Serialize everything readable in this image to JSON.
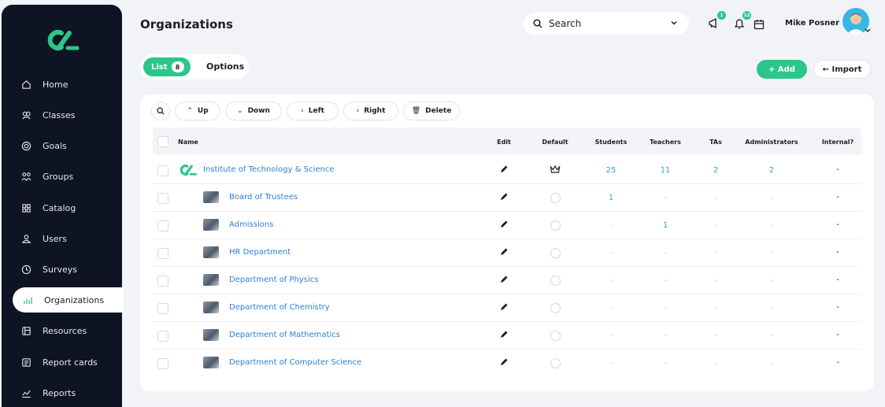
{
  "sidebar": {
    "items": [
      {
        "label": "Home",
        "icon": "home-icon"
      },
      {
        "label": "Classes",
        "icon": "classes-icon"
      },
      {
        "label": "Goals",
        "icon": "goals-icon"
      },
      {
        "label": "Groups",
        "icon": "groups-icon"
      },
      {
        "label": "Catalog",
        "icon": "catalog-icon"
      },
      {
        "label": "Users",
        "icon": "users-icon"
      },
      {
        "label": "Surveys",
        "icon": "surveys-icon"
      },
      {
        "label": "Organizations",
        "icon": "organizations-icon",
        "active": true
      },
      {
        "label": "Resources",
        "icon": "resources-icon"
      },
      {
        "label": "Report cards",
        "icon": "report-cards-icon"
      },
      {
        "label": "Reports",
        "icon": "reports-icon"
      }
    ]
  },
  "header": {
    "title": "Organizations",
    "search_label": "Search",
    "notifications_count": "1",
    "alerts_count": "12",
    "user_name": "Mike Posner"
  },
  "view": {
    "list_label": "List",
    "list_count": "8",
    "options_label": "Options"
  },
  "actions": {
    "add_label": "+ Add",
    "import_label": "← Import"
  },
  "toolbar": {
    "up_label": "Up",
    "down_label": "Down",
    "left_label": "Left",
    "right_label": "Right",
    "delete_label": "Delete"
  },
  "table": {
    "columns": {
      "name": "Name",
      "edit": "Edit",
      "default": "Default",
      "students": "Students",
      "teachers": "Teachers",
      "tas": "TAs",
      "administrators": "Administrators",
      "internal": "Internal?"
    },
    "rows": [
      {
        "name": "Institute of Technology & Science",
        "students": "25",
        "teachers": "11",
        "tas": "2",
        "administrators": "2",
        "internal": "-"
      },
      {
        "name": "Board of Trustees",
        "students": "1",
        "teachers": "-",
        "tas": "-",
        "administrators": "-",
        "internal": "-"
      },
      {
        "name": "Admissions",
        "students": "-",
        "teachers": "1",
        "tas": "-",
        "administrators": "-",
        "internal": "-"
      },
      {
        "name": "HR Department",
        "students": "-",
        "teachers": "-",
        "tas": "-",
        "administrators": "-",
        "internal": "-"
      },
      {
        "name": "Department of Physics",
        "students": "-",
        "teachers": "-",
        "tas": "-",
        "administrators": "-",
        "internal": "-"
      },
      {
        "name": "Department of Chemistry",
        "students": "-",
        "teachers": "-",
        "tas": "-",
        "administrators": "-",
        "internal": "-"
      },
      {
        "name": "Department of Mathematics",
        "students": "-",
        "teachers": "-",
        "tas": "-",
        "administrators": "-",
        "internal": "-"
      },
      {
        "name": "Department of Computer Science",
        "students": "-",
        "teachers": "-",
        "tas": "-",
        "administrators": "-",
        "internal": "-"
      }
    ]
  },
  "colors": {
    "accent": "#2cc58a",
    "sidebar": "#0f1424",
    "link": "#2e7fd4"
  }
}
